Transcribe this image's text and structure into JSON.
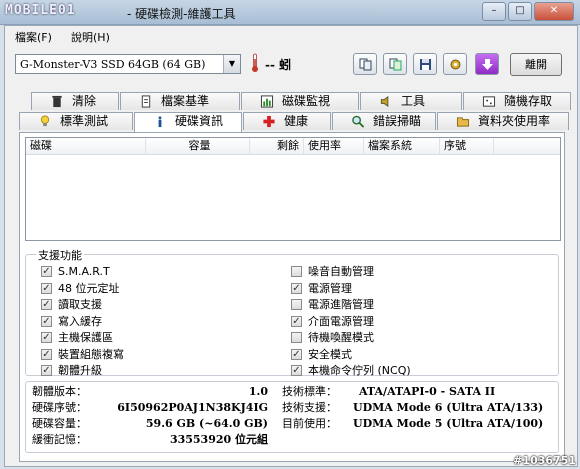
{
  "window": {
    "logo": "MOBILE01",
    "title": "- 硬碟檢測-維護工具",
    "min": "–",
    "max": "□",
    "close": "✕"
  },
  "menu": {
    "file": "檔案(F)",
    "help": "說明(H)"
  },
  "toolbar": {
    "drive": "G-Monster-V3 SSD 64GB (64 GB)",
    "temperature": "-- 蚓",
    "exit": "離開"
  },
  "tabs_top": [
    "清除",
    "檔案基準",
    "磁碟監視",
    "工具",
    "隨機存取"
  ],
  "tabs_bottom": [
    "標準測試",
    "硬碟資訊",
    "健康",
    "錯誤掃瞄",
    "資料夾使用率"
  ],
  "active_tab": "硬碟資訊",
  "list": {
    "columns": [
      "磁碟",
      "容量",
      "剩餘",
      "使用率",
      "檔案系統",
      "序號"
    ]
  },
  "features": {
    "title": "支援功能",
    "left": [
      {
        "label": "S.M.A.R.T",
        "checked": true
      },
      {
        "label": "48 位元定址",
        "checked": true
      },
      {
        "label": "讀取支援",
        "checked": true
      },
      {
        "label": "寫入緩存",
        "checked": true
      },
      {
        "label": "主機保護區",
        "checked": true
      },
      {
        "label": "裝置組態複寫",
        "checked": true
      },
      {
        "label": "韌體升級",
        "checked": true
      }
    ],
    "right": [
      {
        "label": "噪音自動管理",
        "checked": false
      },
      {
        "label": "電源管理",
        "checked": true
      },
      {
        "label": "電源進階管理",
        "checked": false
      },
      {
        "label": "介面電源管理",
        "checked": true
      },
      {
        "label": "待機喚醒模式",
        "checked": false
      },
      {
        "label": "安全模式",
        "checked": true
      },
      {
        "label": "本機命令佇列 (NCQ)",
        "checked": true
      }
    ]
  },
  "details": {
    "firmware_label": "韌體版本：",
    "firmware": "1.0",
    "serial_label": "硬碟序號：",
    "serial": "6I50962P0AJ1N38KJ4IG",
    "capacity_label": "硬碟容量：",
    "capacity": "59.6 GB (~64.0 GB)",
    "buffer_label": "緩衝記憶：",
    "buffer": "33553920 位元組",
    "standard_label": "技術標準：",
    "standard": "ATA/ATAPI-0 - SATA II",
    "support_label": "技術支援：",
    "support": "UDMA Mode 6 (Ultra ATA/133)",
    "current_label": "目前使用：",
    "current": "UDMA Mode 5 (Ultra ATA/100)"
  },
  "watermark": "#1036751",
  "colors": {
    "accent": "#3a6ea5",
    "thermo": "#c0392b",
    "download": "#a23fd6"
  }
}
